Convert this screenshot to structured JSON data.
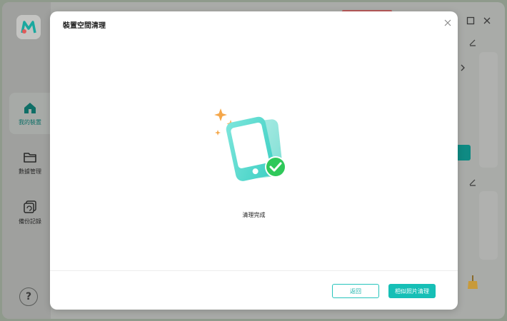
{
  "sidebar": {
    "items": [
      {
        "label": "我的裝置",
        "icon": "home-icon",
        "active": true
      },
      {
        "label": "數據管理",
        "icon": "folder-icon",
        "active": false
      },
      {
        "label": "備份記錄",
        "icon": "backup-icon",
        "active": false
      }
    ],
    "help_label": "?"
  },
  "modal": {
    "title": "裝置空間清理",
    "status": "清理完成",
    "back_label": "返回",
    "similar_photos_label": "相似照片清理"
  },
  "colors": {
    "accent": "#16bfb6",
    "success": "#2fc85a",
    "sparkle": "#f5a74a"
  }
}
